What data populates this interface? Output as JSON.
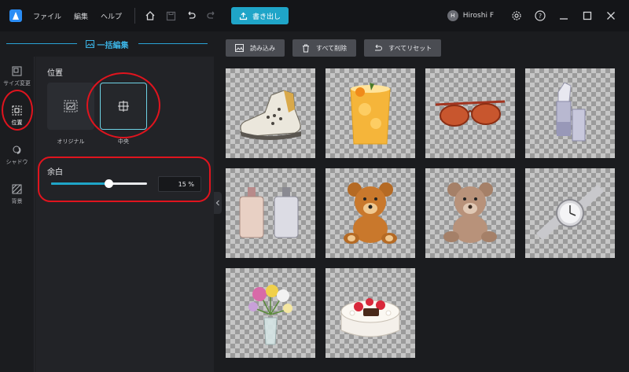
{
  "menu": {
    "file": "ファイル",
    "edit": "編集",
    "help": "ヘルプ"
  },
  "toolbar": {
    "export_label": "書き出し"
  },
  "user": {
    "initial": "H",
    "name": "Hiroshi F"
  },
  "panel": {
    "title": "一括編集"
  },
  "tool_rail": [
    {
      "label": "サイズ変更",
      "icon": "resize-icon"
    },
    {
      "label": "位置",
      "icon": "position-icon"
    },
    {
      "label": "シャドウ",
      "icon": "shadow-icon"
    },
    {
      "label": "背景",
      "icon": "background-icon"
    }
  ],
  "position": {
    "title": "位置",
    "options": [
      {
        "label": "オリジナル"
      },
      {
        "label": "中央"
      }
    ],
    "selected": "中央"
  },
  "margin": {
    "title": "余白",
    "value_display": "15 %",
    "slider_fraction": 0.6
  },
  "actions": {
    "import": "読み込み",
    "delete_all": "すべて削除",
    "reset_all": "すべてリセット"
  },
  "images": [
    "sneaker",
    "orange-drink",
    "sunglasses",
    "lipstick",
    "perfume-bottles",
    "teddy-bear",
    "teddy-bear-light",
    "wristwatch",
    "flower-vase",
    "strawberry-cake"
  ],
  "colors": {
    "accent": "#1fa5c8",
    "highlight": "#e0141e"
  }
}
